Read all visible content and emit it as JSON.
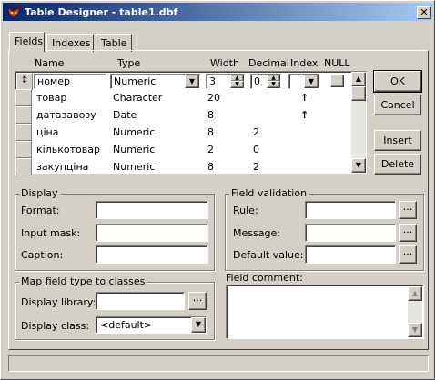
{
  "window": {
    "title": "Table Designer - table1.dbf"
  },
  "tabs": [
    {
      "label": "Fields"
    },
    {
      "label": "Indexes"
    },
    {
      "label": "Table"
    }
  ],
  "grid": {
    "headers": {
      "name": "Name",
      "type": "Type",
      "width": "Width",
      "decimal": "Decimal",
      "index": "Index",
      "null": "NULL"
    },
    "row_marker": "↕",
    "edit_row": {
      "name": "номер",
      "type": "Numeric",
      "width": "3",
      "decimal": "0"
    },
    "rows": [
      {
        "name": "товар",
        "type": "Character",
        "width": "20",
        "decimal": "",
        "index": "↑"
      },
      {
        "name": "датазавозу",
        "type": "Date",
        "width": "8",
        "decimal": "",
        "index": "↑"
      },
      {
        "name": "ціна",
        "type": "Numeric",
        "width": "8",
        "decimal": "2",
        "index": ""
      },
      {
        "name": "кількотовар",
        "type": "Numeric",
        "width": "2",
        "decimal": "0",
        "index": ""
      },
      {
        "name": "закупціна",
        "type": "Numeric",
        "width": "8",
        "decimal": "2",
        "index": ""
      }
    ]
  },
  "buttons": {
    "ok": "OK",
    "cancel": "Cancel",
    "insert": "Insert",
    "delete": "Delete"
  },
  "display": {
    "group_label": "Display",
    "format_label": "Format:",
    "input_mask_label": "Input mask:",
    "caption_label": "Caption:"
  },
  "validation": {
    "group_label": "Field validation",
    "rule_label": "Rule:",
    "message_label": "Message:",
    "default_label": "Default value:"
  },
  "mapping": {
    "group_label": "Map field type to classes",
    "library_label": "Display library:",
    "class_label": "Display class:",
    "class_value": "<default>"
  },
  "comment": {
    "label": "Field comment:"
  },
  "ellipsis": "...",
  "colors": {
    "title_start": "#0a246a",
    "title_end": "#a6caf0",
    "face": "#d4d0c8"
  },
  "icons": {
    "app": "fox-head-icon",
    "close": "close-icon"
  }
}
